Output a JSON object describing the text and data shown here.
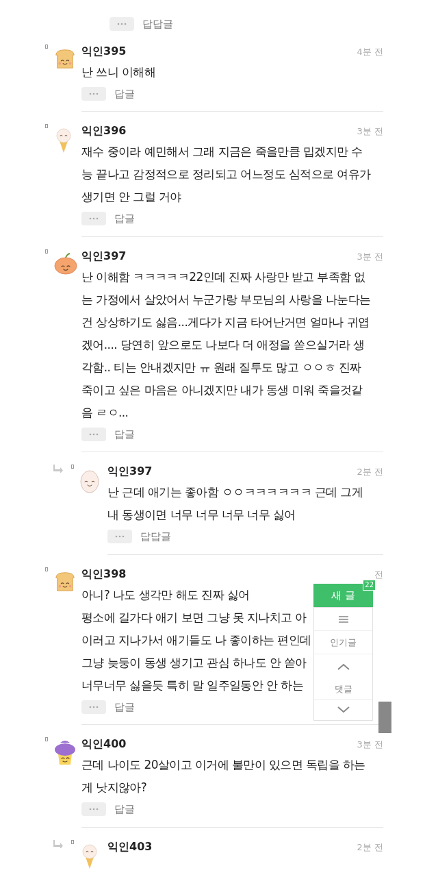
{
  "comments": [
    {
      "kind": "tail",
      "action": "답답글"
    },
    {
      "kind": "comment",
      "name": "익인395",
      "time": "4분 전",
      "lines": [
        "난 쓰니 이해해"
      ],
      "action": "답글"
    },
    {
      "kind": "comment",
      "name": "익인396",
      "time": "3분 전",
      "lines": [
        "재수 중이라 예민해서 그래 지금은 죽을만큼 밉겠지만 수",
        "능 끝나고 감정적으로 정리되고 어느정도 심적으로 여유가",
        "생기면 안 그럴 거야"
      ],
      "action": "답글"
    },
    {
      "kind": "comment",
      "name": "익인397",
      "time": "3분 전",
      "lines": [
        "난 이해함 ㅋㅋㅋㅋㅋ22인데 진짜 사랑만 받고 부족함 없",
        "는 가정에서 살았어서 누군가랑 부모님의 사랑을 나눈다는",
        "건 상상하기도 싫음...게다가 지금 타어난거면 얼마나 귀엽",
        "겠어.... 당연히 앞으로도 나보다 더 애정을 쏟으실거라 생",
        "각함.. 티는 안내겠지만 ㅠ 원래 질투도 많고 ㅇㅇㅎ 진짜",
        "죽이고 싶은 마음은 아니겠지만 내가 동생 미워 죽을것같",
        "음 ㄹㅇ..."
      ],
      "action": "답글"
    },
    {
      "kind": "reply",
      "name": "익인397",
      "time": "2분 전",
      "lines": [
        "난 근데 애기는 좋아함 ㅇㅇㅋㅋㅋㅋㅋㅋ 근데 그게",
        "내 동생이면 너무 너무 너무 너무 싫어"
      ],
      "action": "답답글"
    },
    {
      "kind": "comment",
      "name": "익인398",
      "time": "전",
      "lines": [
        "아니? 나도 생각만 해도 진짜 싫어",
        "평소에 길가다 애기 보면 그냥 못 지나치고 아",
        "이러고 지나가서 애기들도 나 좋이하는 편인데",
        "그냥 늦둥이 동생 생기고 관심 하나도 안 쏟아",
        "너무너무 싫을듯 특히 말 일주일동안 안 하는"
      ],
      "action": "답글"
    },
    {
      "kind": "comment",
      "name": "익인400",
      "time": "3분 전",
      "lines": [
        "근데 나이도 20살이고 이거에 불만이 있으면 독립을 하는",
        "게 낫지않아?"
      ],
      "action": "답글"
    },
    {
      "kind": "reply",
      "name": "익인403",
      "time": "2분 전"
    }
  ],
  "floating_menu": {
    "new_post": "새 글",
    "new_count": "22",
    "popular": "인기글",
    "comments": "댓글"
  }
}
